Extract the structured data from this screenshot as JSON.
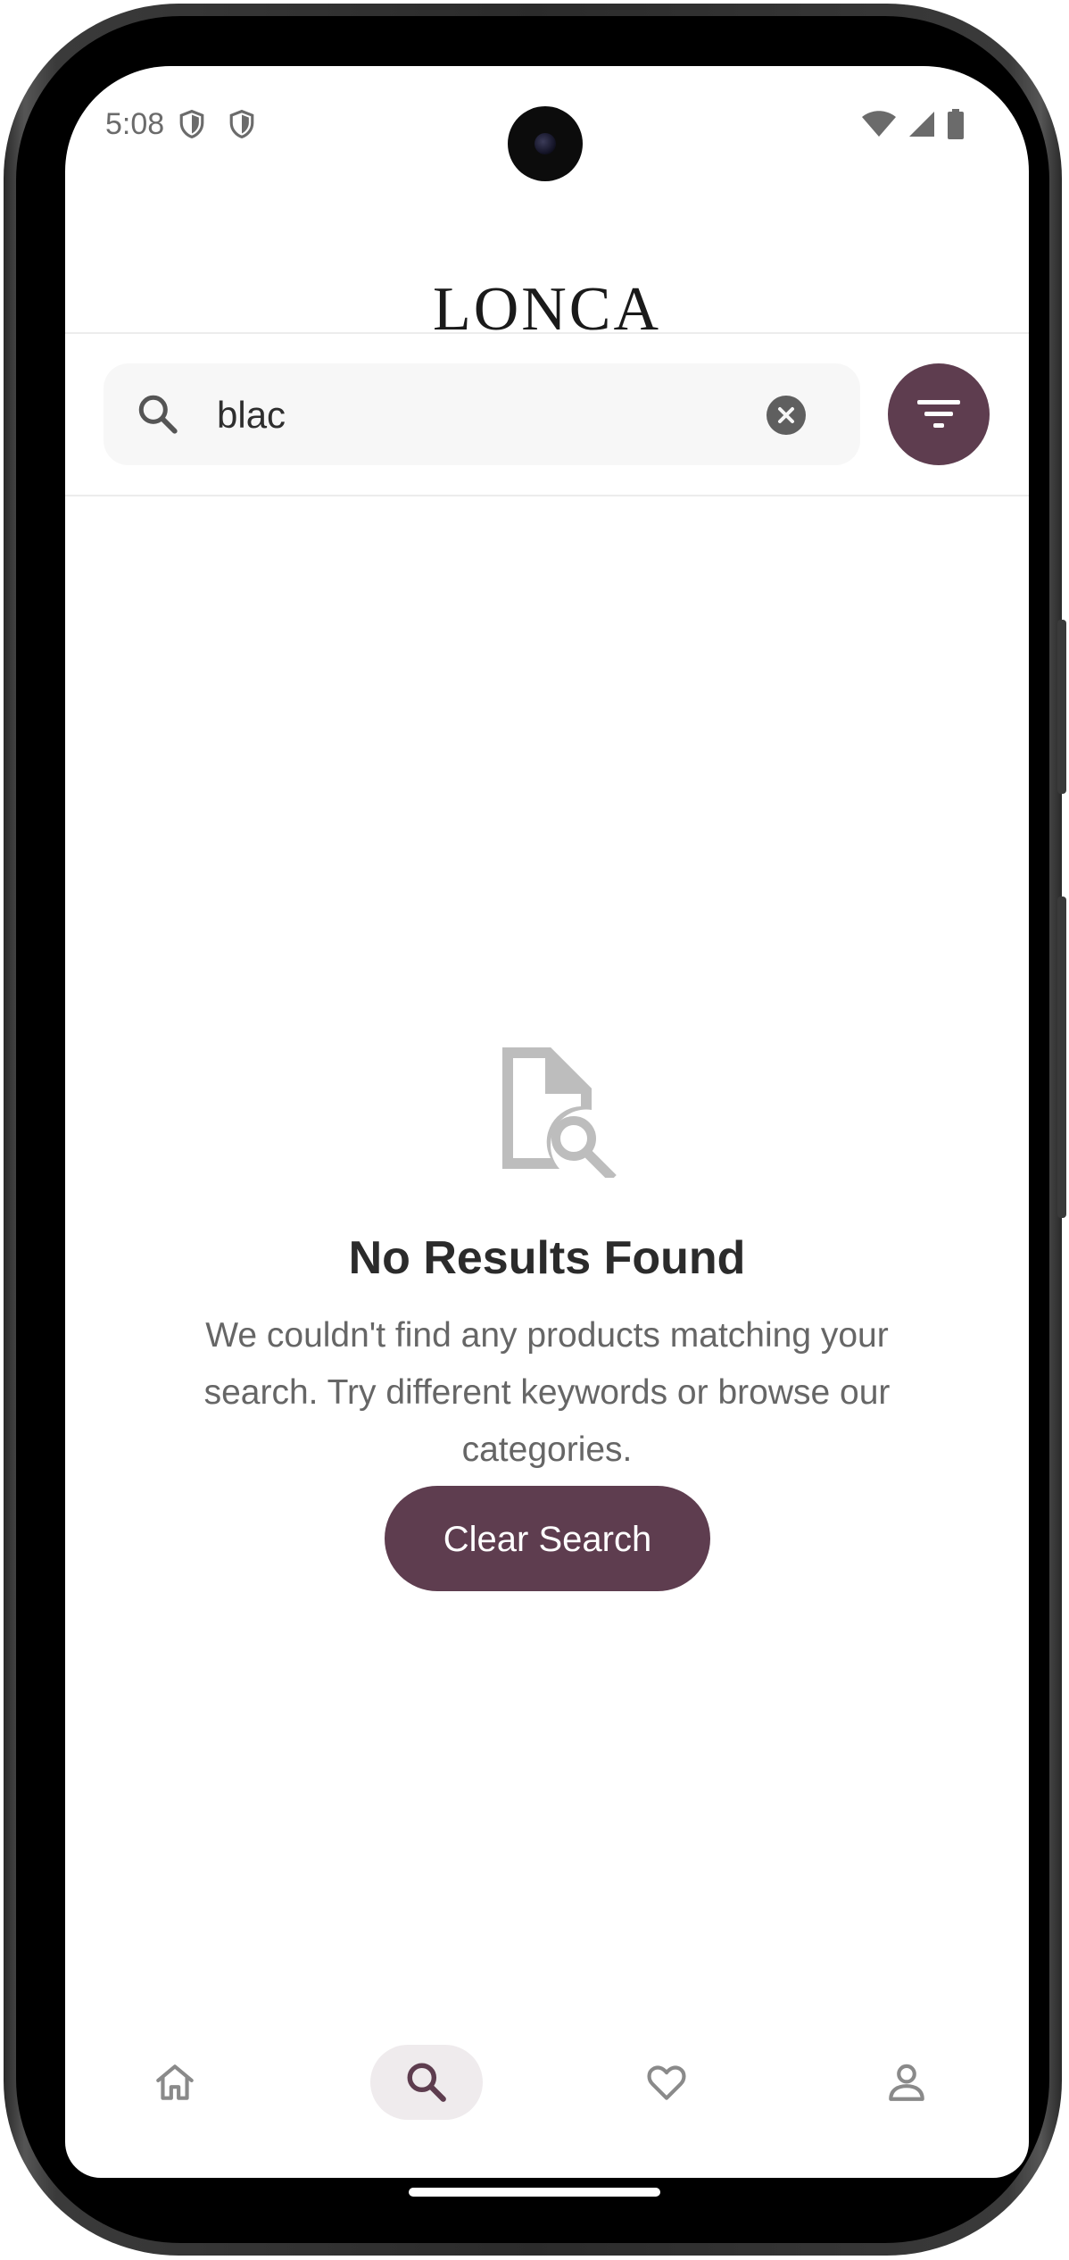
{
  "status_bar": {
    "time": "5:08"
  },
  "header": {
    "logo": "LONCA"
  },
  "search": {
    "value": "blac",
    "placeholder": "",
    "search_icon": "search-icon",
    "clear_icon": "clear-circle-icon"
  },
  "filter": {
    "icon": "filter-icon"
  },
  "empty_state": {
    "icon": "document-search-icon",
    "title": "No Results Found",
    "description": "We couldn't find any products matching your search. Try different keywords or browse our categories.",
    "button_label": "Clear Search"
  },
  "bottom_nav": {
    "items": [
      {
        "icon": "home-icon",
        "active": false
      },
      {
        "icon": "search-icon",
        "active": true
      },
      {
        "icon": "heart-icon",
        "active": false
      },
      {
        "icon": "profile-icon",
        "active": false
      }
    ]
  },
  "colors": {
    "accent": "#5e3d4f",
    "text_primary": "#2b2b2b",
    "text_secondary": "#666666",
    "search_bg": "#f7f7f7"
  }
}
